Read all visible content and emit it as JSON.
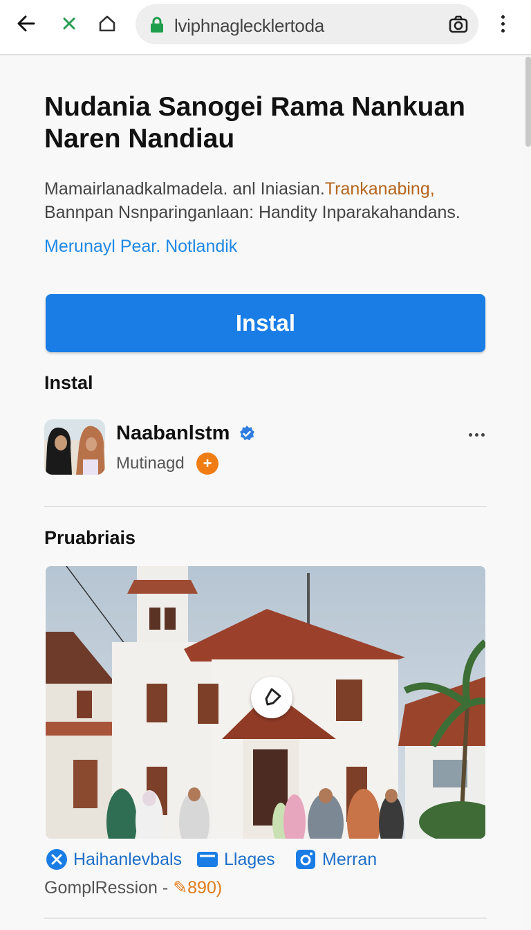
{
  "browser": {
    "url_text": "lviphnaglecklertoda",
    "icons": [
      "back-arrow-icon",
      "close-x-icon",
      "home-icon",
      "lock-icon",
      "camera-icon",
      "more-vert-icon"
    ]
  },
  "page": {
    "title": "Nudania Sanogei Rama Nankuan Naren Nandiau",
    "description_main": "Mamairlanadkalmadela. anl Iniasian.",
    "description_highlight": "Trankanabing,",
    "description_line2": "Bannpan Nsnparinganlaan: Handity Inparakahandans.",
    "link_text": "Merunayl Pear. Notlandik",
    "install_button": "Instal",
    "install_section_label": "Instal",
    "profile": {
      "name": "Naabanlstm",
      "subtitle": "Mutinagd",
      "badge_symbol": "+"
    },
    "preview_section_label": "Pruabriais",
    "chips": [
      {
        "label": "Haihanlevbals",
        "icon": "x-circle-icon"
      },
      {
        "label": "Llages",
        "icon": "mail-icon"
      },
      {
        "label": "Merran",
        "icon": "camera-square-icon"
      }
    ],
    "meta_prefix": "GomplRession -",
    "meta_value": "890)"
  },
  "colors": {
    "accent": "#1a7de6",
    "link": "#1e88e5",
    "highlight": "#b5651d",
    "badge": "#f07d13",
    "lock": "#1e9e4a"
  }
}
